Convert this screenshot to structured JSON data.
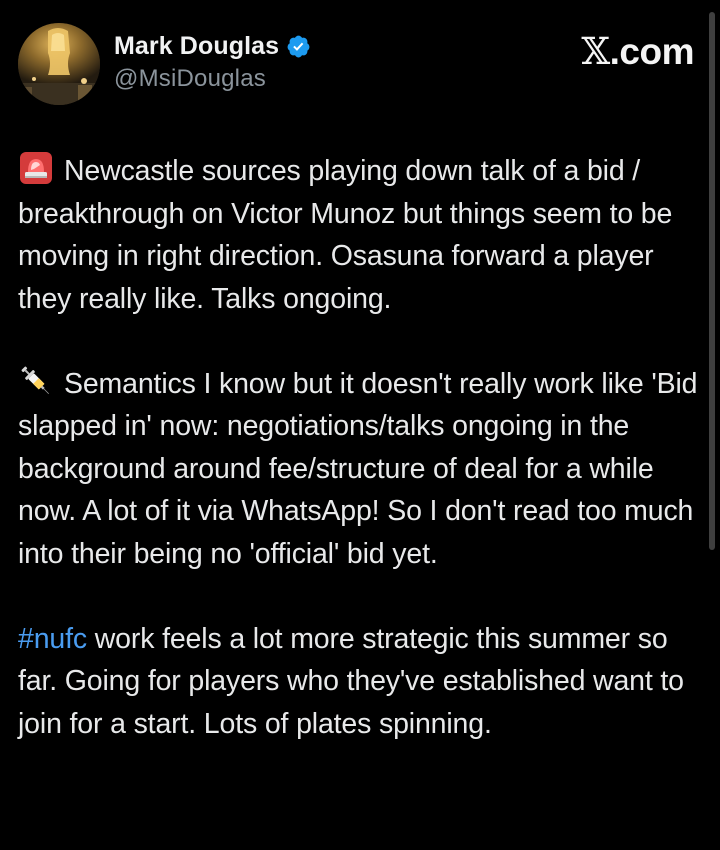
{
  "author": {
    "display_name": "Mark Douglas",
    "handle": "@MsiDouglas",
    "verified_icon": "verified-badge-icon",
    "verified_color": "#1d9bf0"
  },
  "source": {
    "label": ".com",
    "logo_glyph": "𝕏"
  },
  "tweet": {
    "paragraph_1": {
      "emoji": "police-light-icon",
      "text": "Newcastle sources playing down talk of a bid / breakthrough on Victor Munoz but things seem to be moving in right direction. Osasuna forward a player they really like. Talks ongoing."
    },
    "paragraph_2": {
      "emoji": "syringe-icon",
      "text": "Semantics I know but it doesn't really work like 'Bid slapped in' now: negotiations/talks ongoing in the background around fee/structure of deal for a while now. A lot of it via WhatsApp! So I don't read too much into their being no 'official' bid yet."
    },
    "paragraph_3": {
      "hashtag": "#nufc",
      "text": " work feels a lot more strategic this summer so far. Going for players who they've established want to join for a start. Lots of plates spinning."
    }
  },
  "colors": {
    "background": "#000000",
    "text": "#e8e9ea",
    "secondary_text": "#8b949c",
    "link": "#4a9cf0"
  }
}
